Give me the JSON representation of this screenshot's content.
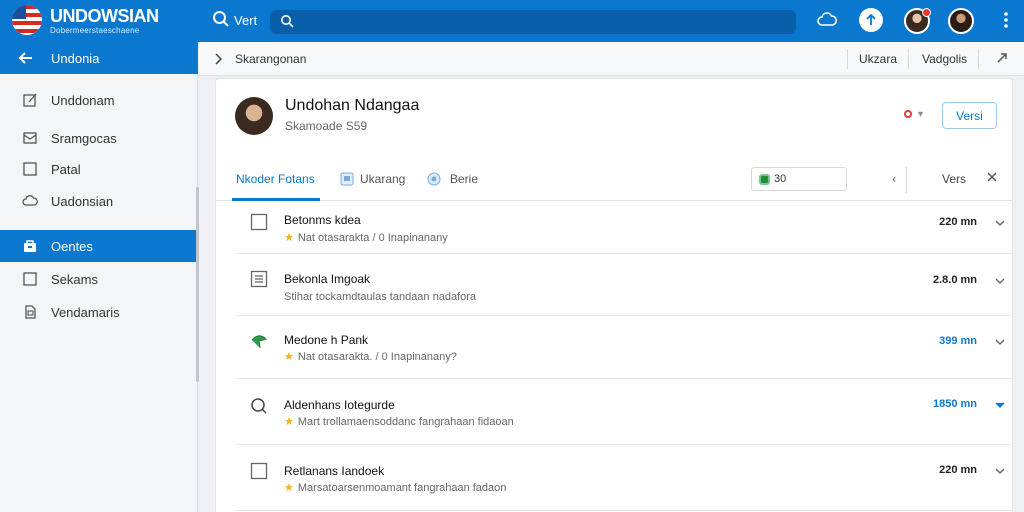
{
  "topbar": {
    "brand": "UNDOWSIAN",
    "brand_sub": "Dobermeerstaeschaene",
    "search_label": "Vert",
    "search_placeholder": "",
    "colors": {
      "bar": "#0b78d0",
      "search": "#0a5fab"
    }
  },
  "sidebar": {
    "header_label": "Undonia",
    "items": [
      {
        "label": "Unddonam",
        "icon": "edit-icon"
      },
      {
        "label": "Sramgocas",
        "icon": "mail-icon"
      },
      {
        "label": "Patal",
        "icon": "square-icon"
      },
      {
        "label": "Uadonsian",
        "icon": "cloud-icon"
      },
      {
        "label": "Oentes",
        "icon": "bag-icon",
        "active": true
      },
      {
        "label": "Sekams",
        "icon": "square-icon"
      },
      {
        "label": "Vendamaris",
        "icon": "document-icon"
      }
    ]
  },
  "breadcrumb": {
    "current": "Skarangonan",
    "action1": "Ukzara",
    "action2": "Vadgolis"
  },
  "profile": {
    "name": "Undohan Ndangaa",
    "subtitle": "Skamoade S59",
    "button_label": "Versi"
  },
  "tabs": {
    "items": [
      {
        "label": "Nkoder Fotans",
        "active": true
      },
      {
        "label": "Ukarang",
        "icon": "image-icon"
      },
      {
        "label": "Berie",
        "icon": "circle-icon"
      }
    ],
    "filter_value": "30",
    "right_label": "Vers"
  },
  "rows": [
    {
      "title": "Betonms kdea",
      "subtitle": "Nat otasarakta / 0 Inapinanany",
      "value": "220 mn",
      "icon": "checkbox-icon",
      "starred": true,
      "value_color": "dark"
    },
    {
      "title": "Bekonla Imgoak",
      "subtitle": "Stihar tockamdtaulas tandaan nadafora",
      "value": "2.8.0 mn",
      "icon": "list-icon",
      "starred": false,
      "value_color": "dark"
    },
    {
      "title": "Medone h Pank",
      "subtitle": "Nat otasarakta. / 0 Inapinanany?",
      "value": "399 mn",
      "icon": "plant-icon",
      "starred": true,
      "value_color": "blue"
    },
    {
      "title": "Aldenhans Iotegurde",
      "subtitle": "Mart trollamaensoddanc fangrahaan fidaoan",
      "value": "1850 mn",
      "icon": "search-icon",
      "starred": true,
      "value_color": "blue"
    },
    {
      "title": "Retlanans Iandoek",
      "subtitle": "Marsatoarsenmoamant fangrahaan fadaon",
      "value": "220 mn",
      "icon": "checkbox-icon",
      "starred": true,
      "value_color": "dark"
    }
  ]
}
